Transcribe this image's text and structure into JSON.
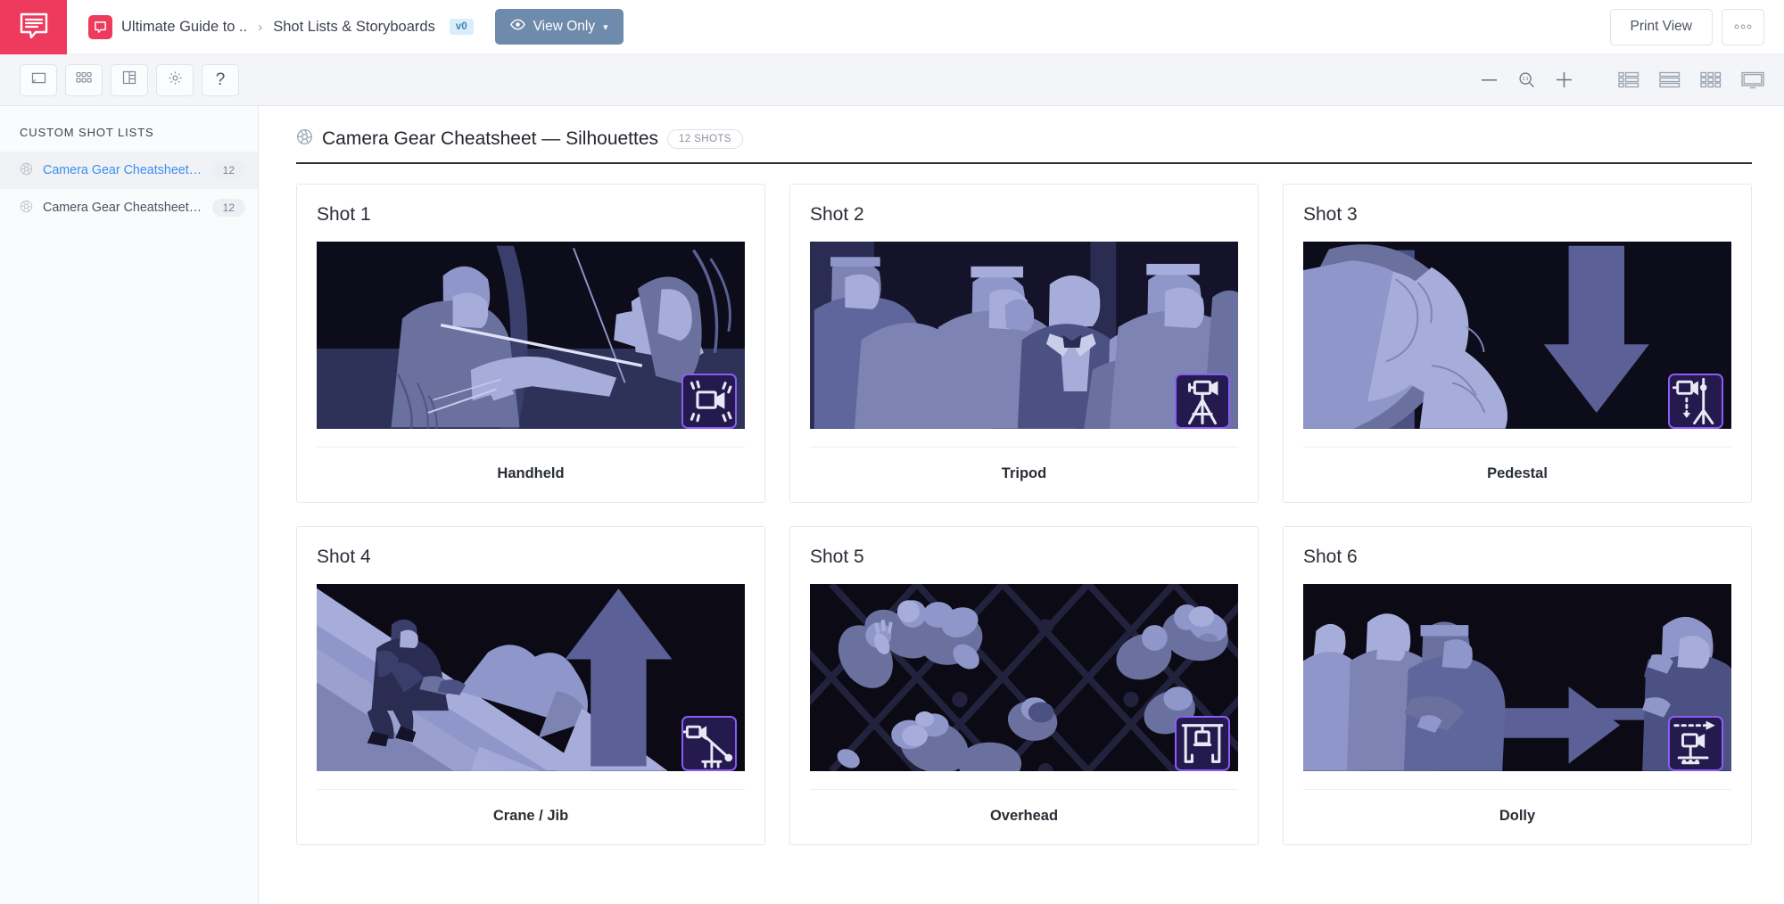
{
  "app": {
    "brand_icon": "studiobinder-logo-icon"
  },
  "topbar": {
    "project_icon": "project-chat-icon",
    "breadcrumb_parent": "Ultimate Guide to ..",
    "breadcrumb_separator": "›",
    "breadcrumb_current": "Shot Lists & Storyboards",
    "version_badge": "v0",
    "view_mode_label": "View Only",
    "view_mode_icon": "eye-icon",
    "view_mode_chevron": "∨",
    "print_view_label": "Print View",
    "more_label": "○○○"
  },
  "toolbar": {
    "left_tools": [
      {
        "name": "board-view-button",
        "icon": "board-icon"
      },
      {
        "name": "grid-view-button",
        "icon": "dot-grid-icon"
      },
      {
        "name": "table-view-button",
        "icon": "table-columns-icon"
      },
      {
        "name": "settings-button",
        "icon": "gear-icon"
      },
      {
        "name": "help-button",
        "icon": "question-mark-icon",
        "glyph": "?"
      }
    ],
    "zoom_out_icon": "minus-icon",
    "zoom_reset_icon": "magnifier-one-to-one-icon",
    "zoom_in_icon": "plus-icon",
    "view_modes": [
      {
        "name": "list-detail-view-button",
        "icon": "list-detail-icon"
      },
      {
        "name": "rows-view-button",
        "icon": "rows-icon"
      },
      {
        "name": "thumbnail-grid-view-button",
        "icon": "thumbnail-grid-icon"
      },
      {
        "name": "presentation-view-button",
        "icon": "presentation-icon"
      }
    ]
  },
  "sidebar": {
    "heading": "CUSTOM SHOT LISTS",
    "items": [
      {
        "label": "Camera Gear Cheatsheet — Silho...",
        "count": "12",
        "icon": "aperture-icon",
        "active": true
      },
      {
        "label": "Camera Gear Cheatsheet — Shots",
        "count": "12",
        "icon": "aperture-icon",
        "active": false
      }
    ]
  },
  "main": {
    "title_icon": "aperture-icon",
    "title": "Camera Gear Cheatsheet — Silhouettes",
    "shots_badge": "12 SHOTS"
  },
  "shots": [
    {
      "number": "Shot 1",
      "label": "Handheld",
      "badge_icon": "handheld-camera-icon",
      "scene": "archery-couple"
    },
    {
      "number": "Shot 2",
      "label": "Tripod",
      "badge_icon": "tripod-camera-icon",
      "scene": "crowd-formal"
    },
    {
      "number": "Shot 3",
      "label": "Pedestal",
      "badge_icon": "pedestal-camera-icon",
      "scene": "profile-down-arrow"
    },
    {
      "number": "Shot 4",
      "label": "Crane / Jib",
      "badge_icon": "crane-jib-camera-icon",
      "scene": "slope-up-arrow"
    },
    {
      "number": "Shot 5",
      "label": "Overhead",
      "badge_icon": "overhead-rig-icon",
      "scene": "aerial-crowd-grid"
    },
    {
      "number": "Shot 6",
      "label": "Dolly",
      "badge_icon": "dolly-camera-icon",
      "scene": "runners-right-arrow"
    }
  ],
  "colors": {
    "brand": "#ee3a5c",
    "accent_blue": "#3b8ef0",
    "badge_border": "#8b5cf6",
    "badge_fill": "#241a4d",
    "viewonly_bg": "#6e8bab",
    "thumb_dark": "#0b0a15",
    "fig_light": "#a7adda",
    "fig_mid": "#737ba8",
    "fig_dark": "#4b5183"
  }
}
